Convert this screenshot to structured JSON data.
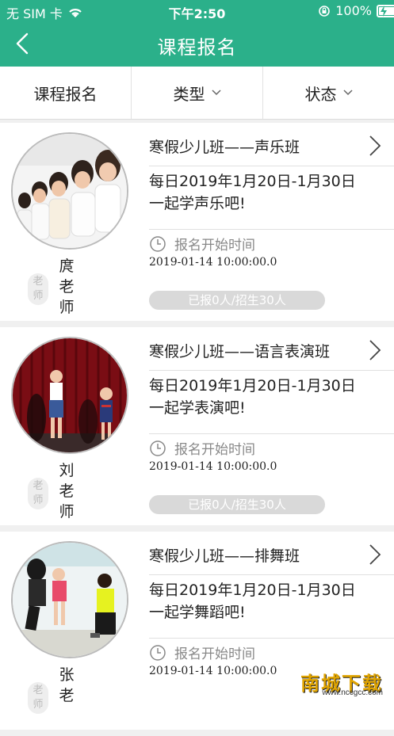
{
  "status_bar": {
    "carrier": "无 SIM 卡",
    "time": "下午2:50",
    "battery": "100%",
    "battery_level": 1.0
  },
  "navbar": {
    "title": "课程报名",
    "back_icon": "chevron-left-icon"
  },
  "tabs": [
    {
      "label": "课程报名"
    },
    {
      "label": "类型"
    },
    {
      "label": "状态"
    }
  ],
  "courses": [
    {
      "title": "寒假少儿班——声乐班",
      "desc_line1": "每日2019年1月20日-1月30日",
      "desc_line2": "一起学声乐吧!",
      "start_label": "报名开始时间",
      "start_date": "2019-01-14 10:00:00.0",
      "enroll": "已报0人/招生30人",
      "teacher": [
        "庹",
        "老",
        "师"
      ]
    },
    {
      "title": "寒假少儿班——语言表演班",
      "desc_line1": "每日2019年1月20日-1月30日",
      "desc_line2": "一起学表演吧!",
      "start_label": "报名开始时间",
      "start_date": "2019-01-14 10:00:00.0",
      "enroll": "已报0人/招生30人",
      "teacher": [
        "刘",
        "老",
        "师"
      ]
    },
    {
      "title": "寒假少儿班——排舞班",
      "desc_line1": "每日2019年1月20日-1月30日",
      "desc_line2": "一起学舞蹈吧!",
      "start_label": "报名开始时间",
      "start_date": "2019-01-14 10:00:00.0",
      "enroll": "",
      "teacher": [
        "张",
        "老",
        ""
      ]
    }
  ],
  "seal": {
    "line1": "老",
    "line2": "师"
  },
  "watermark": {
    "brand": "南城下载",
    "url": "www.nccgcc.com"
  },
  "colors": {
    "accent": "#2bb08a"
  }
}
